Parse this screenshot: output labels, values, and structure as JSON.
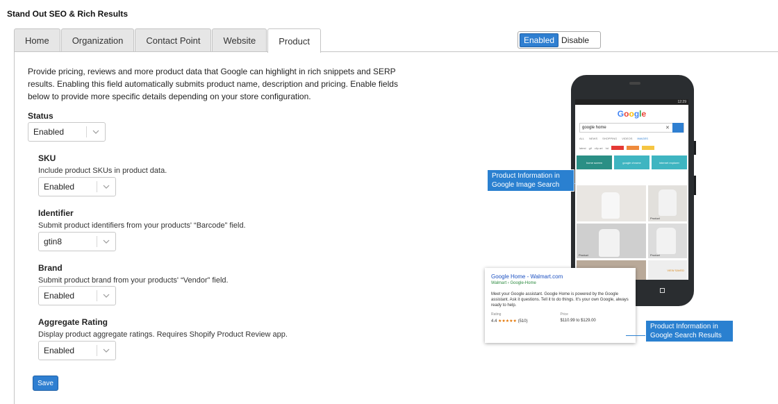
{
  "app": {
    "title": "Stand Out SEO & Rich Results"
  },
  "tabs": [
    {
      "label": "Home",
      "active": false
    },
    {
      "label": "Organization",
      "active": false
    },
    {
      "label": "Contact Point",
      "active": false
    },
    {
      "label": "Website",
      "active": false
    },
    {
      "label": "Product",
      "active": true
    }
  ],
  "toggle": {
    "enabled_label": "Enabled",
    "disable_label": "Disable",
    "state": "Enabled"
  },
  "intro": "Provide pricing, reviews and more product data that Google can highlight in rich snippets and SERP results. Enabling this field automatically submits product name, description and pricing. Enable fields below to provide more specific details depending on your store configuration.",
  "status": {
    "label": "Status",
    "value": "Enabled"
  },
  "fields": {
    "sku": {
      "title": "SKU",
      "description": "Include product SKUs in product data.",
      "value": "Enabled"
    },
    "identifier": {
      "title": "Identifier",
      "description": "Submit product identifiers from your products' “Barcode” field.",
      "value": "gtin8"
    },
    "brand": {
      "title": "Brand",
      "description": "Submit product brand from your products' “Vendor” field.",
      "value": "Enabled"
    },
    "aggregate_rating": {
      "title": "Aggregate Rating",
      "description": "Display product aggregate ratings. Requires Shopify Product Review app.",
      "value": "Enabled"
    }
  },
  "save_label": "Save",
  "illustration": {
    "phone_time": "12:29",
    "google_logo": "Google",
    "search_query": "google home",
    "nav_tabs": [
      "ALL",
      "NEWS",
      "SHOPPING",
      "VIDEOS",
      "IMAGES"
    ],
    "chips": [
      "latest",
      "gif",
      "clip art",
      "hd"
    ],
    "tiles": [
      "home screen",
      "google chrome",
      "internet explorer"
    ],
    "callout_images": "Product Information in Google Image Search",
    "callout_search": "Product Information in Google Search Results",
    "serp": {
      "title": "Google Home - Walmart.com",
      "url": "Walmart › Google-Home",
      "description": "Meet your Google assistant. Google Home is powered by the Google assistant. Ask it questions. Tell it to do things. It's your own Google, always ready to help.",
      "rating_label": "Rating",
      "price_label": "Price",
      "rating_value": "4.4",
      "rating_stars": "★★★★★",
      "rating_count": "(510)",
      "price_value": "$110.99 to $129.00",
      "product_tag": "Product",
      "view_saved": "VIEW SAVED"
    }
  },
  "colors": {
    "accent": "#2f7fd1",
    "tab_bg": "#e6e6e6",
    "callout": "#2a80d0"
  }
}
